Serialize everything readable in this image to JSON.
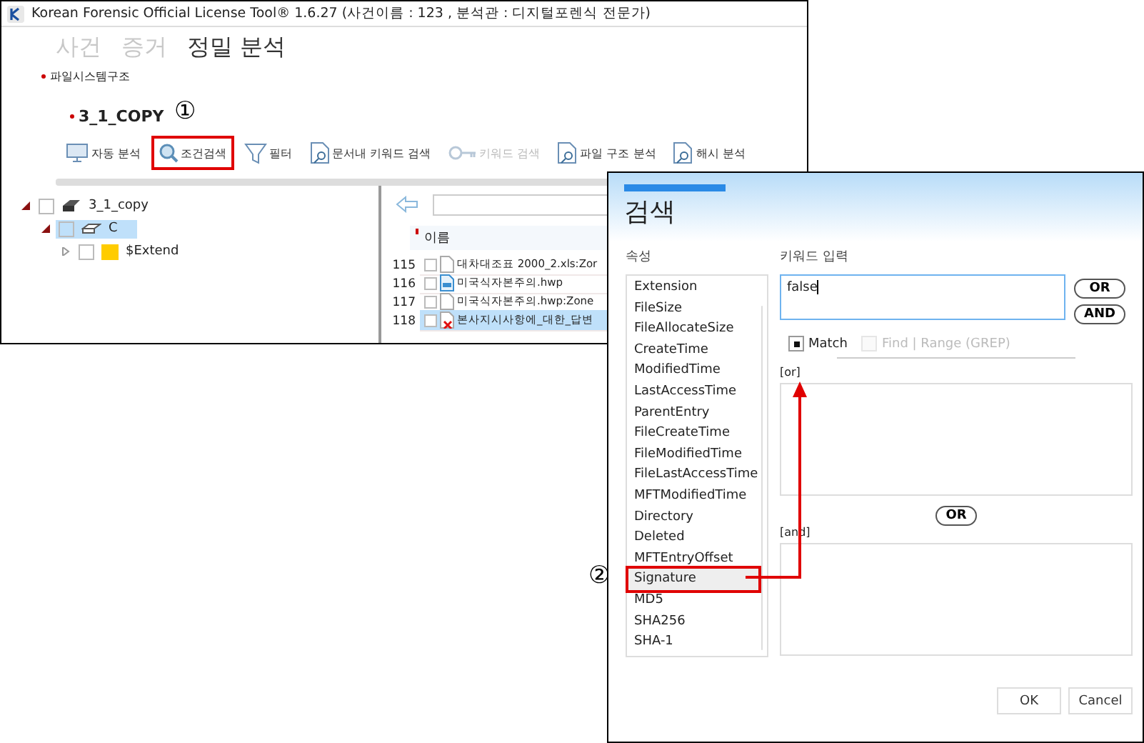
{
  "main_window": {
    "title": "Korean Forensic Official License Tool® 1.6.27 (사건이름 : 123 , 분석관 : 디지털포렌식 전문가)",
    "tabs": [
      {
        "label": "사건",
        "selected": false
      },
      {
        "label": "증거",
        "selected": false
      },
      {
        "label": "정밀 분석",
        "selected": true
      }
    ],
    "section": "파일시스템구조",
    "evidence_name": "3_1_COPY",
    "toolbar": [
      {
        "label": "자동 분석",
        "disabled": false,
        "marked": false
      },
      {
        "label": "조건검색",
        "disabled": false,
        "marked": true
      },
      {
        "label": "필터",
        "disabled": false,
        "marked": false
      },
      {
        "label": "문서내 키워드 검색",
        "disabled": false,
        "marked": false
      },
      {
        "label": "키워드 검색",
        "disabled": true,
        "marked": false
      },
      {
        "label": "파일 구조 분석",
        "disabled": false,
        "marked": false
      },
      {
        "label": "해시 분석",
        "disabled": false,
        "marked": false
      }
    ],
    "tree": [
      {
        "label": "3_1_copy",
        "expanded": true,
        "selected": false,
        "children": [
          {
            "label": "C",
            "expanded": true,
            "selected": true,
            "children": [
              {
                "label": "$Extend",
                "expanded": false,
                "selected": false
              }
            ]
          }
        ]
      }
    ],
    "file_list": {
      "column": "이름",
      "rows": [
        {
          "number": "115",
          "name": "대차대조표 2000_2.xls:Zor",
          "deleted": false,
          "selected": false
        },
        {
          "number": "116",
          "name": "미국식자본주의.hwp",
          "deleted": false,
          "selected": false
        },
        {
          "number": "117",
          "name": "미국식자본주의.hwp:Zone",
          "deleted": false,
          "selected": false
        },
        {
          "number": "118",
          "name": "본사지시사항에_대한_답변",
          "deleted": true,
          "selected": true
        }
      ]
    }
  },
  "dialog": {
    "title": "검색",
    "attributes_label": "속성",
    "keyword_label": "키워드 입력",
    "attributes": [
      {
        "label": "Extension",
        "selected": false
      },
      {
        "label": "FileSize",
        "selected": false
      },
      {
        "label": "FileAllocateSize",
        "selected": false
      },
      {
        "label": "CreateTime",
        "selected": false
      },
      {
        "label": "ModifiedTime",
        "selected": false
      },
      {
        "label": "LastAccessTime",
        "selected": false
      },
      {
        "label": "ParentEntry",
        "selected": false
      },
      {
        "label": "FileCreateTime",
        "selected": false
      },
      {
        "label": "FileModifiedTime",
        "selected": false
      },
      {
        "label": "FileLastAccessTime",
        "selected": false
      },
      {
        "label": "MFTModifiedTime",
        "selected": false
      },
      {
        "label": "Directory",
        "selected": false
      },
      {
        "label": "Deleted",
        "selected": false
      },
      {
        "label": "MFTEntryOffset",
        "selected": false
      },
      {
        "label": "Signature",
        "selected": true
      },
      {
        "label": "MD5",
        "selected": false
      },
      {
        "label": "SHA256",
        "selected": false
      },
      {
        "label": "SHA-1",
        "selected": false
      }
    ],
    "keyword": "false",
    "or_button": "OR",
    "and_button": "AND",
    "options": [
      {
        "label": "Match",
        "checked": true,
        "disabled": false
      },
      {
        "label": "Find | Range (GREP)",
        "checked": false,
        "disabled": true
      }
    ],
    "or_label": "[or]",
    "middle_or_button": "OR",
    "and_label": "[and]",
    "ok": "OK",
    "cancel": "Cancel"
  },
  "annotations": [
    {
      "text": "①"
    },
    {
      "text": "②"
    }
  ]
}
